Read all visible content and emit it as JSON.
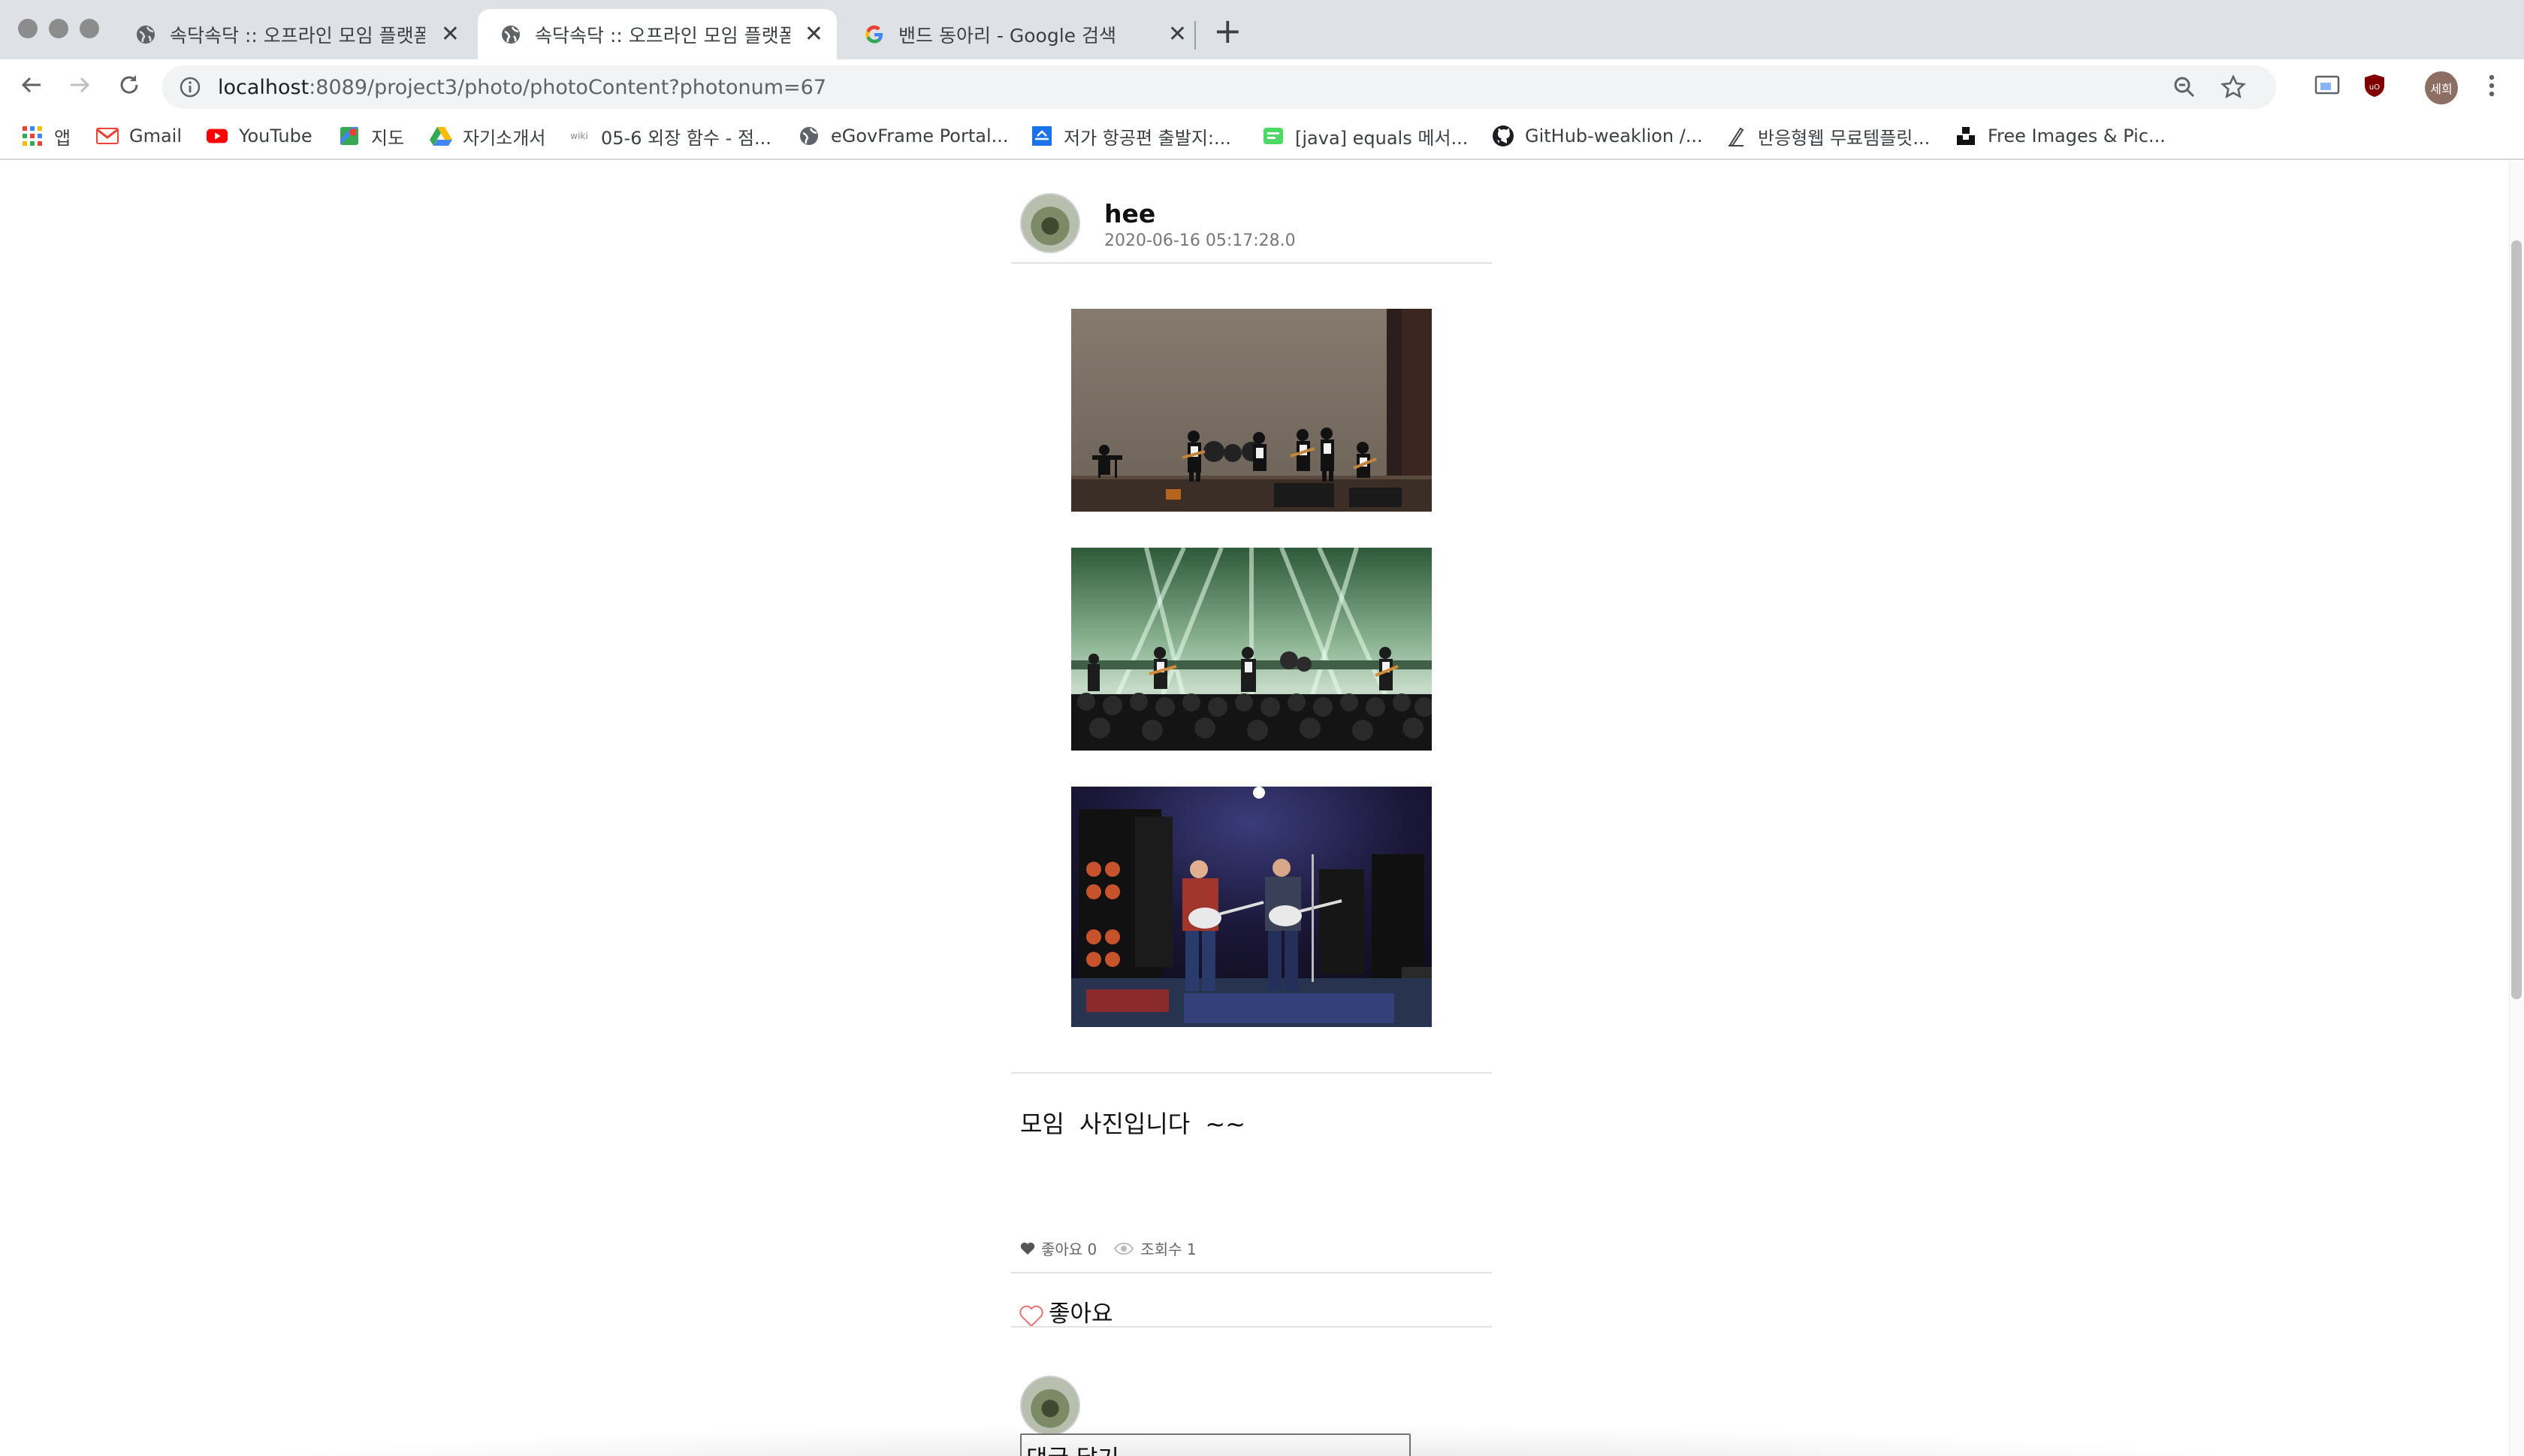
{
  "browser": {
    "tabs": [
      {
        "title": "속닥속닥 :: 오프라인 모임 플랫폼",
        "active": false,
        "icon": "globe-icon"
      },
      {
        "title": "속닥속닥 :: 오프라인 모임 플랫폼",
        "active": true,
        "icon": "globe-icon"
      },
      {
        "title": "밴드 동아리 - Google 검색",
        "active": false,
        "icon": "google-icon"
      }
    ],
    "url_host": "localhost",
    "url_path": ":8089/project3/photo/photoContent?photonum=67",
    "profile_label": "세희",
    "bookmarks": [
      {
        "label": "앱",
        "icon": "apps-grid-icon"
      },
      {
        "label": "Gmail",
        "icon": "gmail-icon"
      },
      {
        "label": "YouTube",
        "icon": "youtube-icon"
      },
      {
        "label": "지도",
        "icon": "maps-icon"
      },
      {
        "label": "자기소개서",
        "icon": "drive-icon"
      },
      {
        "label": "05-6 외장 함수 - 점...",
        "icon": "wikidocs-icon"
      },
      {
        "label": "eGovFrame Portal...",
        "icon": "globe-icon"
      },
      {
        "label": "저가 항공편 출발지:...",
        "icon": "flight-icon"
      },
      {
        "label": "[java] equals 메서...",
        "icon": "chat-icon"
      },
      {
        "label": "GitHub-weaklion /...",
        "icon": "github-icon"
      },
      {
        "label": "반응형웹 무료템플릿...",
        "icon": "pen-icon"
      },
      {
        "label": "Free Images & Pic...",
        "icon": "unsplash-icon"
      }
    ]
  },
  "post": {
    "author": "hee",
    "date": "2020-06-16 05:17:28.0",
    "photos": [
      {
        "name": "band-stage-photo-1",
        "scene": "concert hall stage, band of six"
      },
      {
        "name": "band-stage-photo-2",
        "scene": "green stage lights, crowd"
      },
      {
        "name": "band-stage-photo-3",
        "scene": "club stage, two guitarists"
      }
    ],
    "text": "모임 사진입니다 ~~",
    "likes_label": "좋아요 0",
    "views_label": "조회수 1",
    "like_button_label": "좋아요",
    "comment_placeholder": "댓글 달기"
  },
  "colors": {
    "tabbar": "#dee1e6",
    "heart_outline": "#e57373",
    "text": "#111111"
  }
}
